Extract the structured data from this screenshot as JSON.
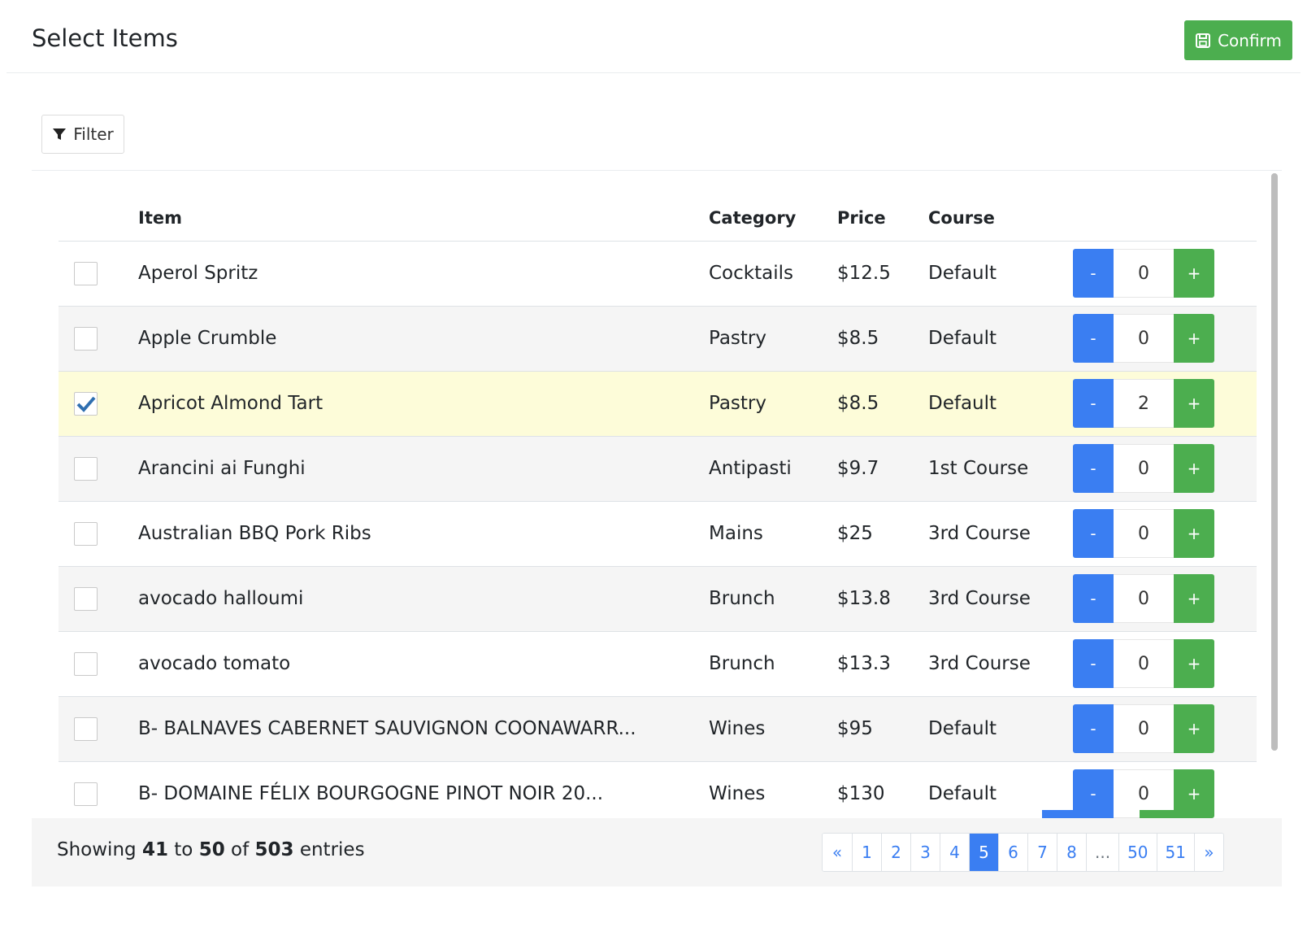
{
  "header": {
    "title": "Select Items",
    "confirm_label": "Confirm"
  },
  "toolbar": {
    "filter_label": "Filter"
  },
  "table": {
    "columns": {
      "item": "Item",
      "category": "Category",
      "price": "Price",
      "course": "Course"
    },
    "rows": [
      {
        "item": "Aperol Spritz",
        "category": "Cocktails",
        "price": "$12.5",
        "course": "Default",
        "qty": "0",
        "checked": false
      },
      {
        "item": "Apple Crumble",
        "category": "Pastry",
        "price": "$8.5",
        "course": "Default",
        "qty": "0",
        "checked": false
      },
      {
        "item": "Apricot Almond Tart",
        "category": "Pastry",
        "price": "$8.5",
        "course": "Default",
        "qty": "2",
        "checked": true
      },
      {
        "item": "Arancini ai Funghi",
        "category": "Antipasti",
        "price": "$9.7",
        "course": "1st Course",
        "qty": "0",
        "checked": false
      },
      {
        "item": "Australian BBQ Pork Ribs",
        "category": "Mains",
        "price": "$25",
        "course": "3rd Course",
        "qty": "0",
        "checked": false
      },
      {
        "item": "avocado halloumi",
        "category": "Brunch",
        "price": "$13.8",
        "course": "3rd Course",
        "qty": "0",
        "checked": false
      },
      {
        "item": "avocado tomato",
        "category": "Brunch",
        "price": "$13.3",
        "course": "3rd Course",
        "qty": "0",
        "checked": false
      },
      {
        "item": "B- BALNAVES CABERNET SAUVIGNON COONAWARR...",
        "category": "Wines",
        "price": "$95",
        "course": "Default",
        "qty": "0",
        "checked": false
      },
      {
        "item": "B- DOMAINE FÉLIX BOURGOGNE PINOT NOIR 20...",
        "category": "Wines",
        "price": "$130",
        "course": "Default",
        "qty": "0",
        "checked": false
      }
    ],
    "minus_label": "-",
    "plus_label": "+"
  },
  "footer": {
    "showing_prefix": "Showing",
    "from": "41",
    "to_word": "to",
    "to": "50",
    "of_word": "of",
    "total": "503",
    "entries_word": "entries"
  },
  "pagination": {
    "prev": "«",
    "next": "»",
    "pages": [
      "1",
      "2",
      "3",
      "4",
      "5",
      "6",
      "7",
      "8",
      "...",
      "50",
      "51"
    ],
    "active": "5"
  },
  "colors": {
    "primary": "#3a7ef2",
    "success": "#4cae4f",
    "selected_row": "#fdfcd9",
    "striped_row": "#f5f5f5"
  }
}
